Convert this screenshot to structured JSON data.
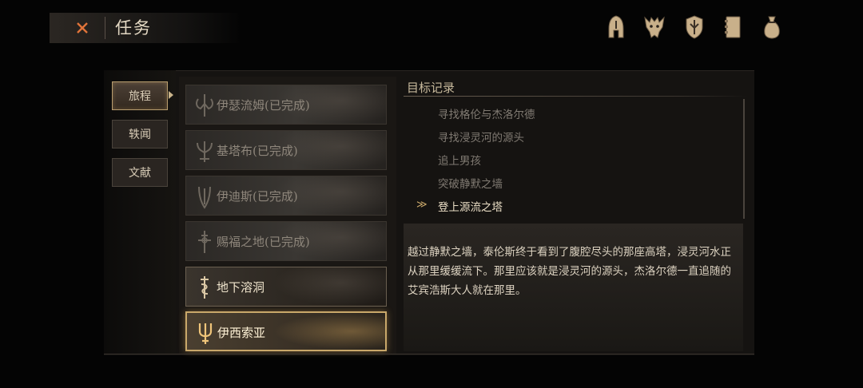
{
  "header": {
    "title": "任务",
    "close_icon": "close-x-icon"
  },
  "top_icons": [
    {
      "name": "helmet-icon"
    },
    {
      "name": "beast-skull-icon"
    },
    {
      "name": "shield-icon"
    },
    {
      "name": "journal-icon"
    },
    {
      "name": "pouch-icon"
    }
  ],
  "tabs": [
    {
      "label": "旅程",
      "active": true
    },
    {
      "label": "轶闻",
      "active": false
    },
    {
      "label": "文献",
      "active": false
    }
  ],
  "quests": [
    {
      "label": "伊瑟流姆(已完成)",
      "state": "done",
      "icon": "crossed-axes-icon"
    },
    {
      "label": "基塔布(已完成)",
      "state": "done",
      "icon": "horned-emblem-icon"
    },
    {
      "label": "伊迪斯(已完成)",
      "state": "done",
      "icon": "dagger-emblem-icon"
    },
    {
      "label": "赐福之地(已完成)",
      "state": "done",
      "icon": "sword-cross-icon"
    },
    {
      "label": "地下溶洞",
      "state": "normal",
      "icon": "serpent-staff-icon"
    },
    {
      "label": "伊西索亚",
      "state": "selected",
      "icon": "trident-emblem-icon"
    }
  ],
  "objectives": {
    "title": "目标记录",
    "items": [
      {
        "text": "寻找格伦与杰洛尔德",
        "current": false
      },
      {
        "text": "寻找浸灵河的源头",
        "current": false
      },
      {
        "text": "追上男孩",
        "current": false
      },
      {
        "text": "突破静默之墙",
        "current": false
      },
      {
        "text": "登上源流之塔",
        "current": true
      }
    ],
    "marker": "≫"
  },
  "description": "越过静默之墙，泰伦斯终于看到了腹腔尽头的那座高塔，浸灵河水正从那里缓缓流下。那里应该就是浸灵河的源头，杰洛尔德一直追随的艾宾浩斯大人就在那里。",
  "colors": {
    "accent": "#c9a86a",
    "bg": "#040404",
    "panel": "#151311",
    "close": "#e0743a"
  }
}
